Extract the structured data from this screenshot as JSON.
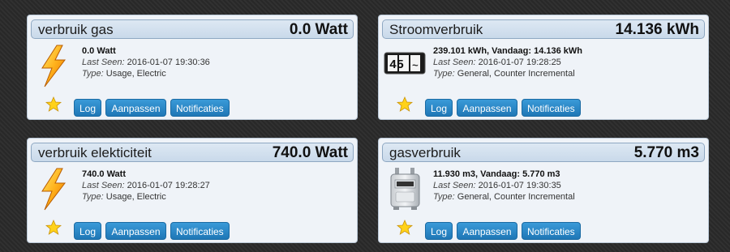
{
  "buttons": {
    "log": "Log",
    "edit": "Aanpassen",
    "notifications": "Notificaties"
  },
  "cards": [
    {
      "title": "verbruik gas",
      "value": "0.0 Watt",
      "icon": "lightning-icon",
      "data": "0.0 Watt",
      "last_seen_label": "Last Seen:",
      "last_seen": "2016-01-07 19:30:36",
      "type_label": "Type:",
      "type": "Usage, Electric"
    },
    {
      "title": "Stroomverbruik",
      "value": "14.136 kWh",
      "icon": "counter-icon",
      "counter_digits": "45",
      "data": "239.101 kWh, Vandaag: 14.136 kWh",
      "last_seen_label": "Last Seen:",
      "last_seen": "2016-01-07 19:28:25",
      "type_label": "Type:",
      "type": "General, Counter Incremental"
    },
    {
      "title": "verbruik elekticiteit",
      "value": "740.0 Watt",
      "icon": "lightning-icon",
      "data": "740.0 Watt",
      "last_seen_label": "Last Seen:",
      "last_seen": "2016-01-07 19:28:27",
      "type_label": "Type:",
      "type": "Usage, Electric"
    },
    {
      "title": "gasverbruik",
      "value": "5.770 m3",
      "icon": "gas-meter-icon",
      "data": "11.930 m3, Vandaag: 5.770 m3",
      "last_seen_label": "Last Seen:",
      "last_seen": "2016-01-07 19:30:35",
      "type_label": "Type:",
      "type": "General, Counter Incremental"
    }
  ]
}
